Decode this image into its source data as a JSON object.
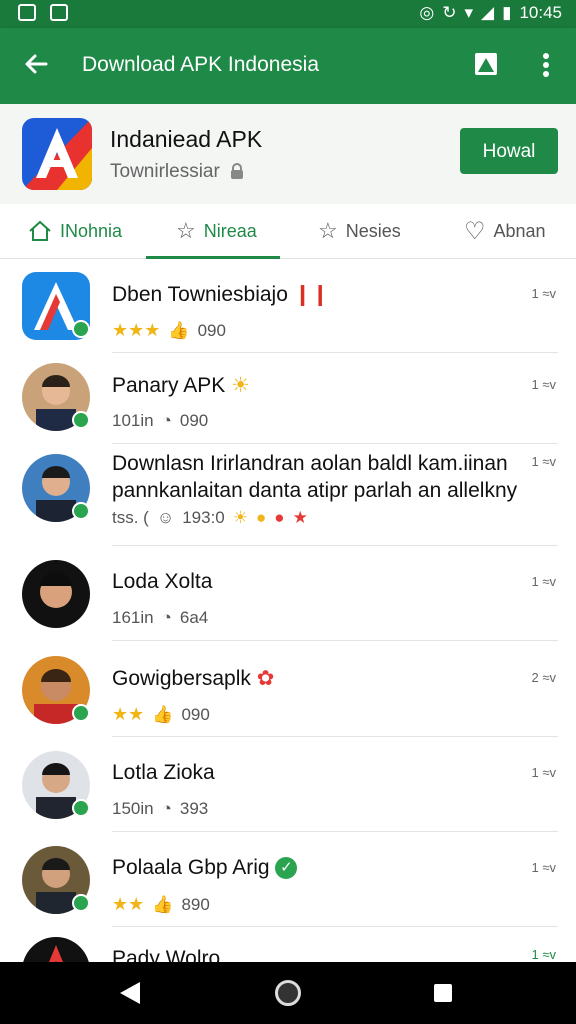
{
  "status_bar": {
    "time": "10:45"
  },
  "app_bar": {
    "title": "Download APK Indonesia"
  },
  "app_header": {
    "name": "Indaniead APK",
    "subtitle": "Townirlessiar",
    "install_label": "Howal"
  },
  "tabs": [
    {
      "label": "INohnia",
      "icon": "home-icon",
      "active": true
    },
    {
      "label": "Nireaa",
      "icon": "star-icon",
      "active": false
    },
    {
      "label": "Nesies",
      "icon": "star-icon",
      "active": false
    },
    {
      "label": "Abnan",
      "icon": "heart-icon",
      "active": false
    }
  ],
  "list": [
    {
      "title": "Dben Towniesbiajo",
      "meta_left": "",
      "meta_count": "090",
      "time": "1 ≈v"
    },
    {
      "title": "Panary APK",
      "meta_left": "101in",
      "meta_count": "090",
      "time": "1 ≈v"
    },
    {
      "title_line1": "Downlasn Irirlandran aolan baldl kam.iinan",
      "title_line2": "pannkanlaitan danta atipr parlah an allelkny",
      "meta_left": "tss. (",
      "meta_count": "193:0",
      "time": "1 ≈v"
    },
    {
      "title": "Loda Xolta",
      "meta_left": "161in",
      "meta_count": "6a4",
      "time": "1 ≈v"
    },
    {
      "title": "Gowigbersaplk",
      "meta_left": "",
      "meta_count": "090",
      "time": "2 ≈v"
    },
    {
      "title": "Lotla Zioka",
      "meta_left": "150in",
      "meta_count": "393",
      "time": "1 ≈v"
    },
    {
      "title": "Polaala Gbp Arig",
      "meta_left": "",
      "meta_count": "890",
      "time": "1 ≈v"
    },
    {
      "title": "Pady Wolro",
      "time": "1 ≈v"
    }
  ],
  "colors": {
    "primary": "#1f8a47",
    "status_bar": "#1a7a3b",
    "star": "#f2b517"
  }
}
